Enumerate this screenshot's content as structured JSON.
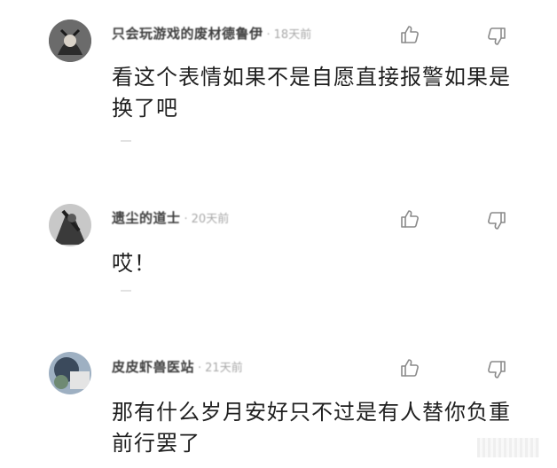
{
  "comments": [
    {
      "username": "只会玩游戏的废材德鲁伊",
      "dot": "·",
      "time": "18天前",
      "text": "看这个表情如果不是自愿直接报警如果是换了吧"
    },
    {
      "username": "遗尘的道士",
      "dot": "·",
      "time": "20天前",
      "text": "哎！"
    },
    {
      "username": "皮皮虾兽医站",
      "dot": "·",
      "time": "21天前",
      "text": "那有什么岁月安好只不过是有人替你负重前行罢了"
    }
  ],
  "icons": {
    "like": "thumbs-up-icon",
    "dislike": "thumbs-down-icon"
  },
  "colors": {
    "username": "#3d3d3d",
    "meta": "#a8a8a8",
    "text": "#1f1f1f",
    "icon": "#8a8a8a"
  }
}
